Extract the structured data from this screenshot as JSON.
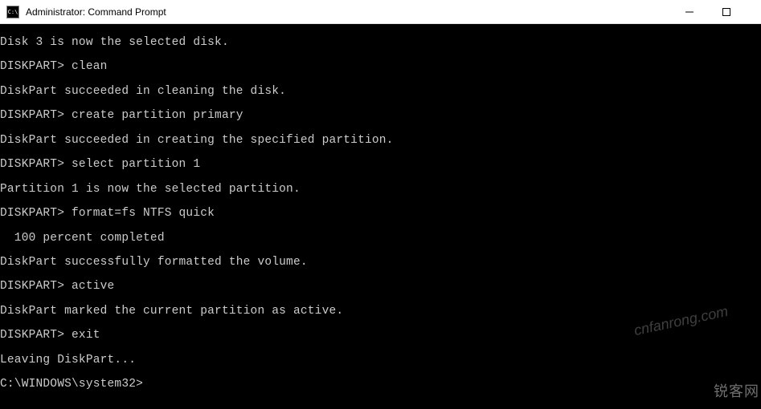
{
  "window": {
    "title": "Administrator: Command Prompt",
    "icon_text": "C:\\"
  },
  "terminal": {
    "lines": [
      "Disk 3 is now the selected disk.",
      "DISKPART> clean",
      "DiskPart succeeded in cleaning the disk.",
      "DISKPART> create partition primary",
      "DiskPart succeeded in creating the specified partition.",
      "DISKPART> select partition 1",
      "Partition 1 is now the selected partition.",
      "DISKPART> format=fs NTFS quick",
      "  100 percent completed",
      "DiskPart successfully formatted the volume.",
      "DISKPART> active",
      "DiskPart marked the current partition as active.",
      "DISKPART> exit",
      "Leaving DiskPart...",
      "C:\\WINDOWS\\system32>"
    ]
  },
  "watermarks": {
    "w1": "cnfanrong.com",
    "w2": "锐客网"
  }
}
